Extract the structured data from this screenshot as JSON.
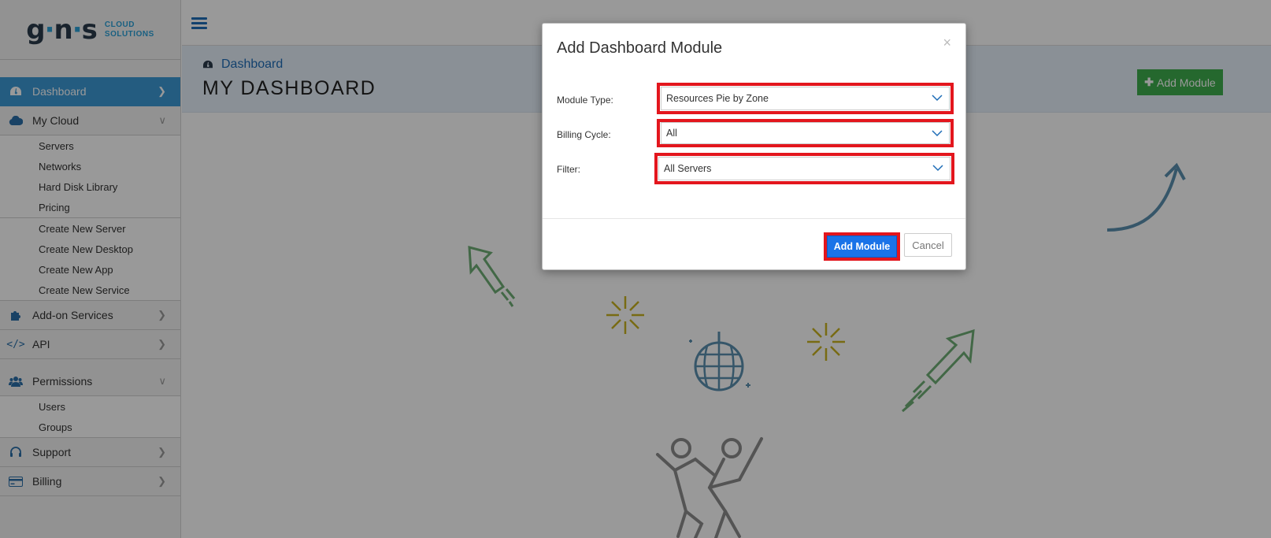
{
  "brand": {
    "logo_text": "gns",
    "tagline_line1": "CLOUD",
    "tagline_line2": "SOLUTIONS"
  },
  "sidebar": {
    "items": [
      {
        "label": "Dashboard",
        "icon": "dashboard-icon",
        "active": true
      },
      {
        "label": "My Cloud",
        "icon": "cloud-icon",
        "expanded": true,
        "children": [
          "Servers",
          "Networks",
          "Hard Disk Library",
          "Pricing"
        ],
        "children2": [
          "Create New Server",
          "Create New Desktop",
          "Create New App",
          "Create New Service"
        ]
      },
      {
        "label": "Add-on Services",
        "icon": "puzzle-icon"
      },
      {
        "label": "API",
        "icon": "code-icon"
      },
      {
        "label": "Permissions",
        "icon": "users-icon",
        "expanded": true,
        "children": [
          "Users",
          "Groups"
        ]
      },
      {
        "label": "Support",
        "icon": "headset-icon"
      },
      {
        "label": "Billing",
        "icon": "credit-card-icon"
      }
    ]
  },
  "header": {
    "breadcrumb": "Dashboard",
    "title": "MY DASHBOARD",
    "add_module_label": "Add Module"
  },
  "modal": {
    "title": "Add Dashboard Module",
    "close": "×",
    "fields": {
      "module_type": {
        "label": "Module Type:",
        "value": "Resources Pie by Zone"
      },
      "billing_cycle": {
        "label": "Billing Cycle:",
        "value": "All"
      },
      "filter": {
        "label": "Filter:",
        "value": "All Servers"
      }
    },
    "submit_label": "Add Module",
    "cancel_label": "Cancel"
  },
  "colors": {
    "accent": "#3d99d6",
    "highlight": "#e3161d",
    "primary_button": "#1a73e8",
    "success": "#3eae4d"
  }
}
